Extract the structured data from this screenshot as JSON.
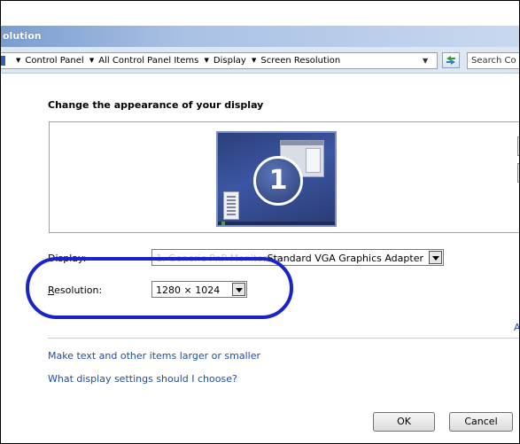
{
  "window": {
    "title": "olution"
  },
  "address_bar": {
    "breadcrumbs": [
      "Control Panel",
      "All Control Panel Items",
      "Display",
      "Screen Resolution"
    ],
    "search_placeholder": "Search Co"
  },
  "content": {
    "heading": "Change the appearance of your display",
    "monitor_number": "1",
    "display_label": "Display:",
    "display_value": "Standard VGA Graphics Adapter",
    "display_value_faded": "1. Generic PnP Monitor on",
    "resolution_label_first": "R",
    "resolution_label_rest": "esolution:",
    "resolution_value": "1280 × 1024",
    "advanced_link": "A",
    "links": [
      "Make text and other items larger or smaller",
      "What display settings should I choose?"
    ]
  },
  "buttons": {
    "ok": "OK",
    "cancel": "Cancel"
  },
  "colors": {
    "highlight_oval": "#1a23c8",
    "link": "#1d4da8",
    "titlebar": "#7a9dd0"
  }
}
